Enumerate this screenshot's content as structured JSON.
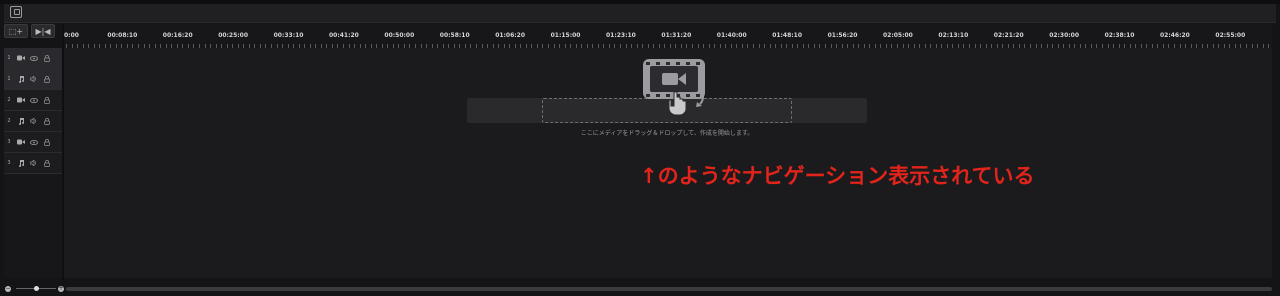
{
  "toolbar": {
    "icon": "import-icon"
  },
  "tools": {
    "left": "⬚+",
    "right": "▶|◀"
  },
  "ruler": {
    "labels": [
      "0:00",
      "00:08:10",
      "00:16:20",
      "00:25:00",
      "00:33:10",
      "00:41:20",
      "00:50:00",
      "00:58:10",
      "01:06:20",
      "01:15:00",
      "01:23:10",
      "01:31:20",
      "01:40:00",
      "01:48:10",
      "01:56:20",
      "02:05:00",
      "02:13:10",
      "02:21:20",
      "02:30:00",
      "02:38:10",
      "02:46:20",
      "02:55:00"
    ]
  },
  "tracks": [
    {
      "num": "1",
      "type": "video"
    },
    {
      "num": "1",
      "type": "audio"
    },
    {
      "num": "2",
      "type": "video"
    },
    {
      "num": "2",
      "type": "audio"
    },
    {
      "num": "3",
      "type": "video"
    },
    {
      "num": "3",
      "type": "audio"
    }
  ],
  "drop": {
    "hint": "ここにメディアをドラッグ＆ドロップして、作成を開始します。"
  },
  "annotation": {
    "text": "↑のようなナビゲーション表示されている"
  },
  "colors": {
    "accent": "#e3241b",
    "bg": "#1b1b1e"
  }
}
